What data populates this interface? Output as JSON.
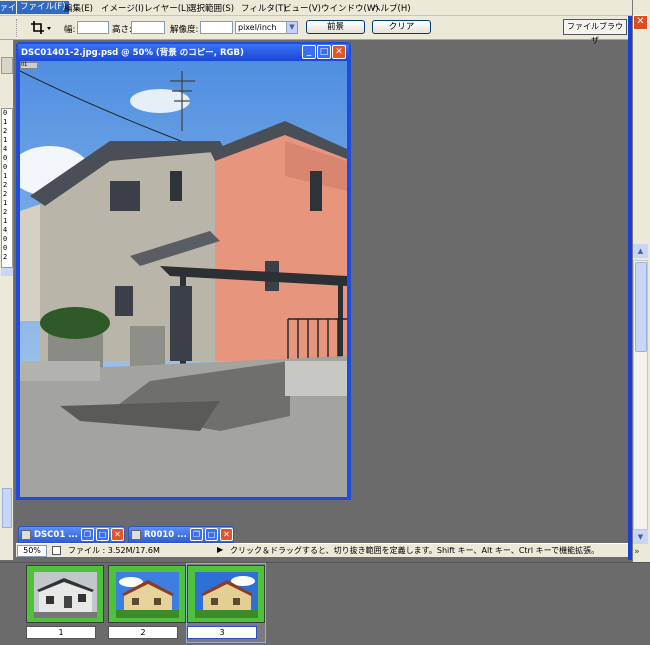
{
  "menubar": {
    "cut_label": "ァイル",
    "items": [
      {
        "id": "file",
        "label": "ファイル(F)"
      },
      {
        "id": "edit",
        "label": "編集(E)"
      },
      {
        "id": "image",
        "label": "イメージ(I)"
      },
      {
        "id": "layer",
        "label": "レイヤー(L)"
      },
      {
        "id": "select",
        "label": "選択範囲(S)"
      },
      {
        "id": "filter",
        "label": "フィルタ(T)"
      },
      {
        "id": "view",
        "label": "ビュー(V)"
      },
      {
        "id": "window",
        "label": "ウインドウ(W)"
      },
      {
        "id": "help",
        "label": "ヘルプ(H)"
      }
    ]
  },
  "options": {
    "width_label": "幅:",
    "width_value": "",
    "height_label": "高さ:",
    "height_value": "",
    "resolution_label": "解像度:",
    "resolution_value": "",
    "unit_value": "pixel/inch",
    "front_button": "前景",
    "clear_button": "クリア",
    "file_browser_button": "ファイルブラウザ"
  },
  "left_sliver_text": "0\n1\n2\n1\n4\n0\n0\n1\n2\n2\n1\n2\n1\n4\n0\n0\n2",
  "document": {
    "title": "DSC01401-2.jpg.psd @ 50% (背景 のコピー, RGB)",
    "ruler_tag": "01"
  },
  "minimized_windows": [
    {
      "title": "DSC01 ..."
    },
    {
      "title": "R0010 ..."
    }
  ],
  "status": {
    "zoom": "50%",
    "file_info": "ファイル : 3.52M/17.6M",
    "hint": "クリック＆ドラッグすると、切り抜き範囲を定義します。Shift キー、Alt キー、Ctrl キーで機能拡張。"
  },
  "filmstrip": [
    {
      "label": "1"
    },
    {
      "label": "2"
    },
    {
      "label": "3"
    }
  ],
  "colors": {
    "title_blue": "#1e4cdc",
    "xp_beige": "#ece9d8",
    "workspace_gray": "#6b6b6b",
    "thumb_green": "#4ec23a"
  }
}
